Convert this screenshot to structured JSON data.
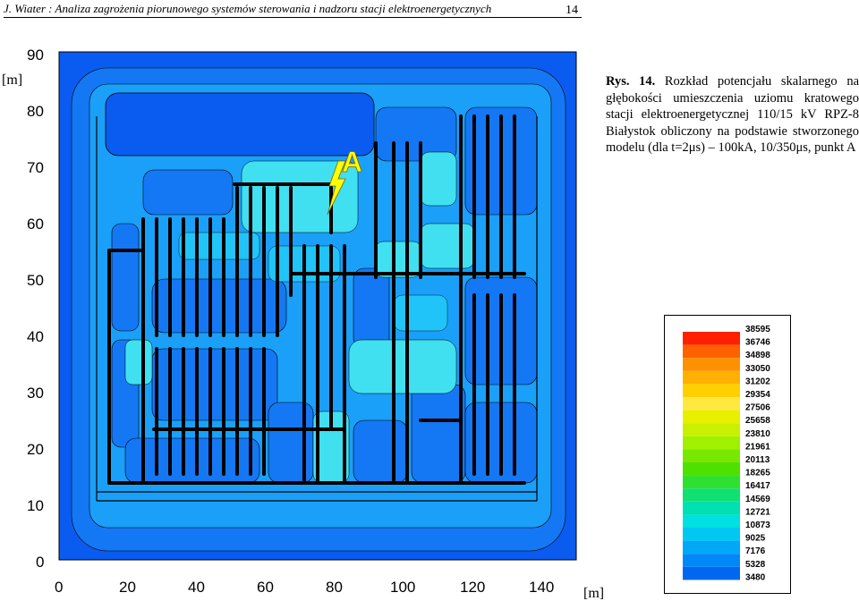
{
  "header": {
    "text": "J. Wiater : Analiza zagrożenia piorunowego systemów sterowania i nadzoru stacji elektroenergetycznych",
    "page_number": "14"
  },
  "caption": {
    "label": "Rys. 14.",
    "text": "Rozkład potencjału skalarnego na głębokości umieszczenia uziomu kratowego stacji elektroenergetycznej 110/15 kV RPZ-8 Białystok obliczony na podstawie stworzonego modelu (dla t=2μs) – 100kA, 10/350μs, punkt A"
  },
  "plot": {
    "y_unit": "[m]",
    "x_unit": "[m]",
    "y_ticks": [
      "0",
      "10",
      "20",
      "30",
      "40",
      "50",
      "60",
      "70",
      "80",
      "90"
    ],
    "x_ticks": [
      "0",
      "20",
      "40",
      "60",
      "80",
      "100",
      "120",
      "140"
    ],
    "point_label": "A",
    "colors": {
      "background": "#0a5cf0",
      "level1": "#1478f5",
      "level2": "#1aa0f8",
      "level3": "#20c4f8",
      "level4": "#40e0f0",
      "conductor": "#000000",
      "lightning": "#ffff00"
    }
  },
  "legend": {
    "values": [
      "38595",
      "36746",
      "34898",
      "33050",
      "31202",
      "29354",
      "27506",
      "25658",
      "23810",
      "21961",
      "20113",
      "18265",
      "16417",
      "14569",
      "12721",
      "10873",
      "9025",
      "7176",
      "5328",
      "3480"
    ],
    "colors": [
      "#ff2000",
      "#ff6000",
      "#ff9000",
      "#ffb000",
      "#ffd000",
      "#ffe840",
      "#e8f000",
      "#c8f000",
      "#a0f000",
      "#78e800",
      "#50e000",
      "#30e030",
      "#10e070",
      "#00e0b0",
      "#00e0e0",
      "#00c8f0",
      "#00a8f8",
      "#0088f8",
      "#0068f0",
      "#0048e8"
    ]
  }
}
